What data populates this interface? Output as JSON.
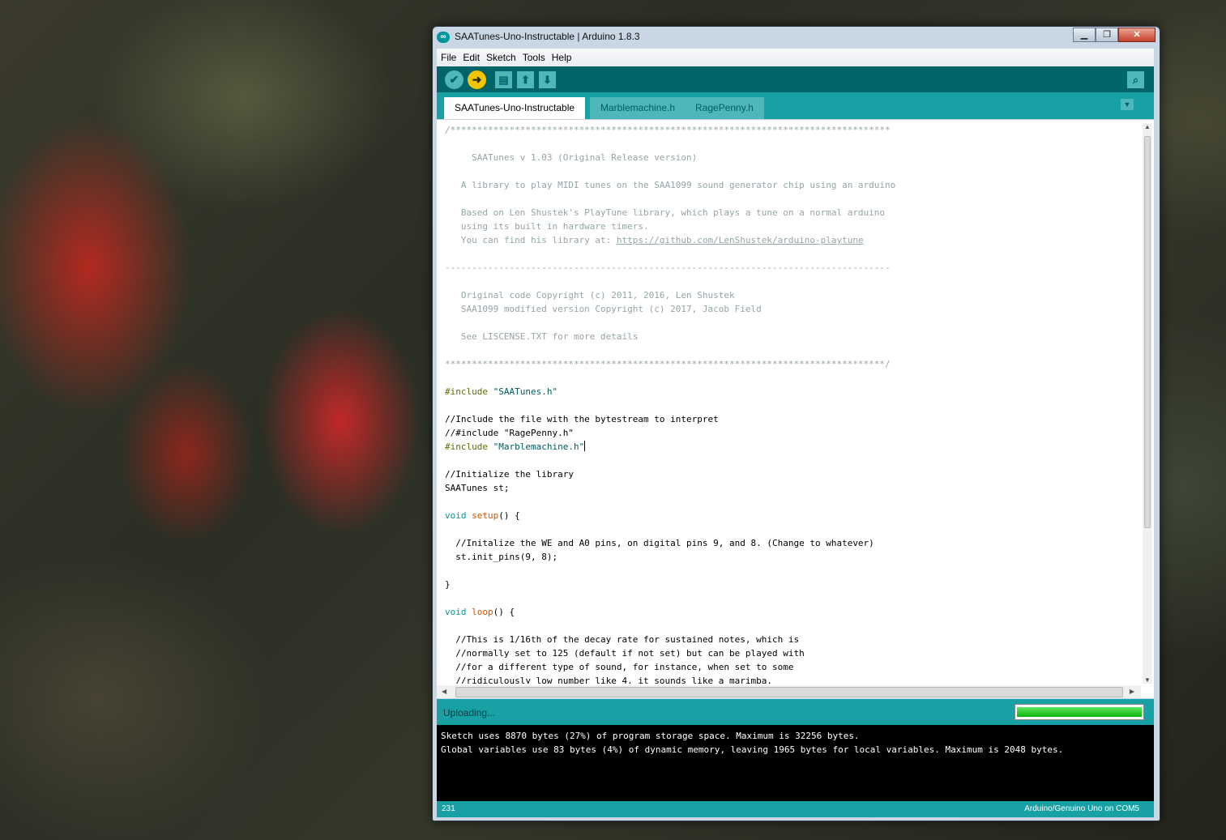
{
  "window": {
    "title": "SAATunes-Uno-Instructable | Arduino 1.8.3",
    "controls": {
      "minimize": "▁",
      "maximize": "❐",
      "close": "✕"
    }
  },
  "menu": [
    "File",
    "Edit",
    "Sketch",
    "Tools",
    "Help"
  ],
  "toolbar": {
    "verify_icon": "check-icon",
    "upload_icon": "arrow-right-icon",
    "new_icon": "new-file-icon",
    "open_icon": "arrow-up-icon",
    "save_icon": "arrow-down-icon",
    "serial_monitor_icon": "magnifier-icon",
    "accent": "#006468",
    "button_color": "#4db7bb",
    "upload_active_color": "#f5c400"
  },
  "tabs": [
    {
      "label": "SAATunes-Uno-Instructable",
      "active": true
    },
    {
      "label": "Marblemachine.h",
      "active": false
    },
    {
      "label": "RagePenny.h",
      "active": false
    }
  ],
  "code_lines": [
    [
      {
        "t": "/**********************************************************************************",
        "c": "comment"
      }
    ],
    [
      {
        "t": "",
        "c": "plain"
      }
    ],
    [
      {
        "t": "     SAATunes v 1.03 (Original Release version)",
        "c": "comment"
      }
    ],
    [
      {
        "t": "",
        "c": "plain"
      }
    ],
    [
      {
        "t": "   A library to play MIDI tunes on the SAA1099 sound generator chip using an arduino",
        "c": "comment"
      }
    ],
    [
      {
        "t": "",
        "c": "plain"
      }
    ],
    [
      {
        "t": "   Based on Len Shustek's PlayTune library, which plays a tune on a normal arduino",
        "c": "comment"
      }
    ],
    [
      {
        "t": "   using its built in hardware timers.",
        "c": "comment"
      }
    ],
    [
      {
        "t": "   You can find his library at: ",
        "c": "comment"
      },
      {
        "t": "https://github.com/LenShustek/arduino-playtune",
        "c": "comment link"
      }
    ],
    [
      {
        "t": "",
        "c": "plain"
      }
    ],
    [
      {
        "t": "-----------------------------------------------------------------------------------",
        "c": "comment"
      }
    ],
    [
      {
        "t": "",
        "c": "plain"
      }
    ],
    [
      {
        "t": "   Original code Copyright (c) 2011, 2016, Len Shustek",
        "c": "comment"
      }
    ],
    [
      {
        "t": "   SAA1099 modified version Copyright (c) 2017, Jacob Field",
        "c": "comment"
      }
    ],
    [
      {
        "t": "",
        "c": "plain"
      }
    ],
    [
      {
        "t": "   See LISCENSE.TXT for more details",
        "c": "comment"
      }
    ],
    [
      {
        "t": "",
        "c": "plain"
      }
    ],
    [
      {
        "t": "**********************************************************************************/",
        "c": "comment"
      }
    ],
    [
      {
        "t": "",
        "c": "plain"
      }
    ],
    [
      {
        "t": "#include ",
        "c": "pre"
      },
      {
        "t": "\"SAATunes.h\"",
        "c": "str"
      }
    ],
    [
      {
        "t": "",
        "c": "plain"
      }
    ],
    [
      {
        "t": "//Include the file with the bytestream to interpret",
        "c": "plain"
      }
    ],
    [
      {
        "t": "//#include \"RagePenny.h\"",
        "c": "plain"
      }
    ],
    [
      {
        "t": "#include ",
        "c": "pre"
      },
      {
        "t": "\"Marblemachine.h\"",
        "c": "str"
      },
      {
        "t": "",
        "c": "cursor"
      }
    ],
    [
      {
        "t": "",
        "c": "plain"
      }
    ],
    [
      {
        "t": "//Initialize the library",
        "c": "plain"
      }
    ],
    [
      {
        "t": "SAATunes st;",
        "c": "plain"
      }
    ],
    [
      {
        "t": "",
        "c": "plain"
      }
    ],
    [
      {
        "t": "void",
        "c": "kw"
      },
      {
        "t": " ",
        "c": "plain"
      },
      {
        "t": "setup",
        "c": "fn"
      },
      {
        "t": "() {",
        "c": "plain"
      }
    ],
    [
      {
        "t": "",
        "c": "plain"
      }
    ],
    [
      {
        "t": "  //Initalize the WE and A0 pins, on digital pins 9, and 8. (Change to whatever)",
        "c": "plain"
      }
    ],
    [
      {
        "t": "  st.init_pins(9, 8);",
        "c": "plain"
      }
    ],
    [
      {
        "t": "",
        "c": "plain"
      }
    ],
    [
      {
        "t": "}",
        "c": "plain"
      }
    ],
    [
      {
        "t": "",
        "c": "plain"
      }
    ],
    [
      {
        "t": "void",
        "c": "kw"
      },
      {
        "t": " ",
        "c": "plain"
      },
      {
        "t": "loop",
        "c": "fn"
      },
      {
        "t": "() {",
        "c": "plain"
      }
    ],
    [
      {
        "t": "",
        "c": "plain"
      }
    ],
    [
      {
        "t": "  //This is 1/16th of the decay rate for sustained notes, which is",
        "c": "plain"
      }
    ],
    [
      {
        "t": "  //normally set to 125 (default if not set) but can be played with",
        "c": "plain"
      }
    ],
    [
      {
        "t": "  //for a different type of sound, for instance, when set to some",
        "c": "plain"
      }
    ],
    [
      {
        "t": "  //ridiculously low number like 4, it sounds like a marimba.",
        "c": "plain"
      }
    ]
  ],
  "status": {
    "text": "Uploading...",
    "progress": 1.0,
    "progress_color": "#0db40d"
  },
  "console_lines": [
    "Sketch uses 8870 bytes (27%) of program storage space. Maximum is 32256 bytes.",
    "Global variables use 83 bytes (4%) of dynamic memory, leaving 1965 bytes for local variables. Maximum is 2048 bytes."
  ],
  "footer": {
    "line_number": "231",
    "board": "Arduino/Genuino Uno on COM5"
  },
  "editor_scroll": {
    "h_thumb_glyph": "|||",
    "v_thumb_glyph": "≡"
  }
}
